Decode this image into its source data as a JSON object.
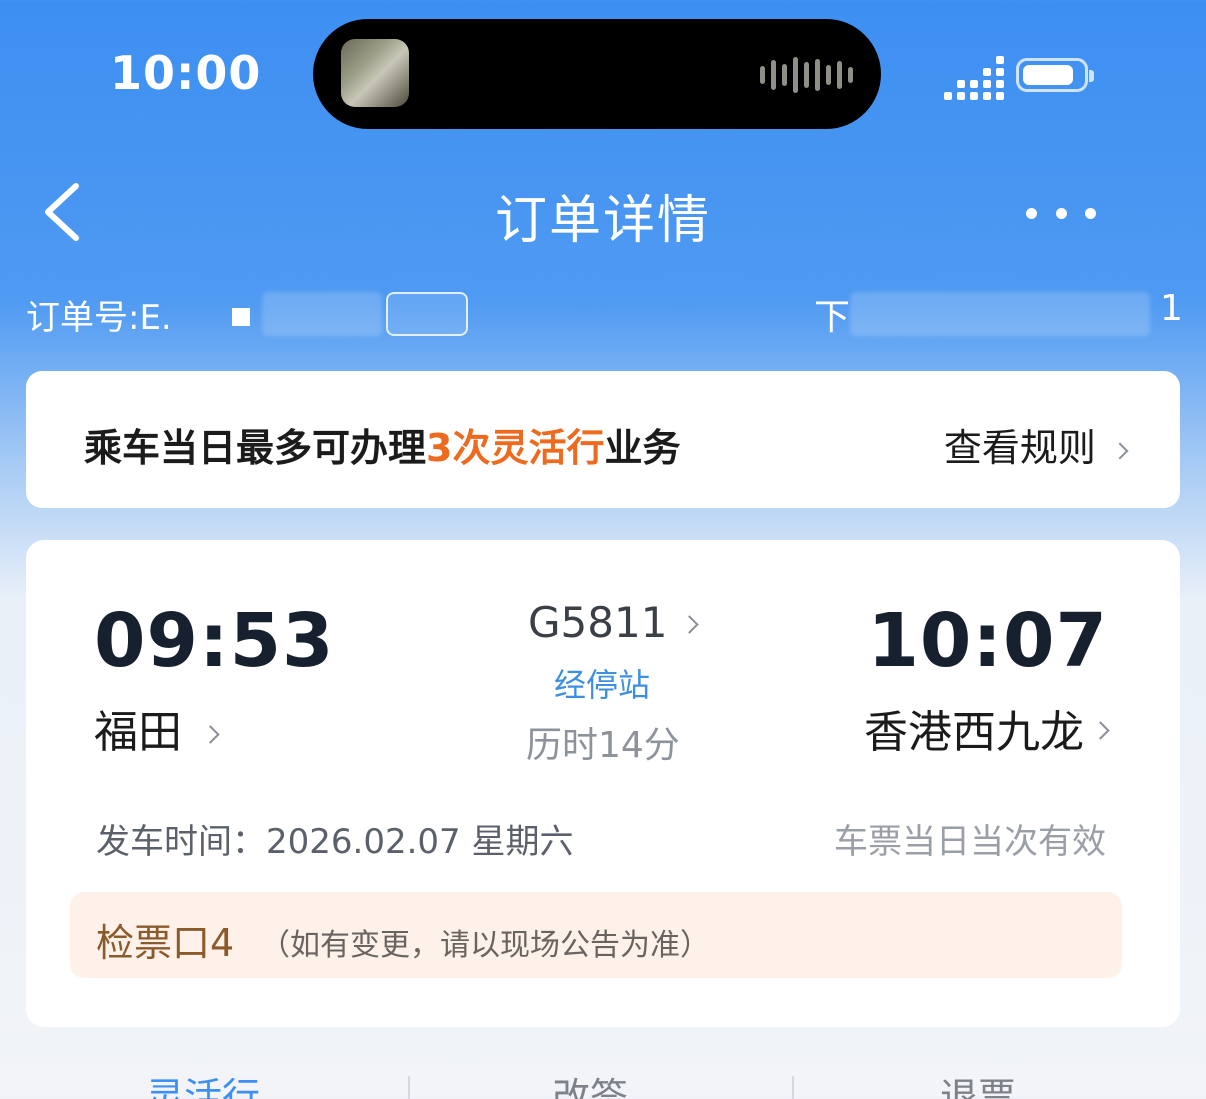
{
  "status_bar": {
    "time": "10:00"
  },
  "nav": {
    "title": "订单详情",
    "back_icon": "chevron-left-icon",
    "more_icon": "more-dots-icon"
  },
  "order": {
    "label": "订单号:E.",
    "right_prefix": "下",
    "right_suffix": "1"
  },
  "notice": {
    "text_prefix": "乘车当日最多可办理",
    "text_highlight": "3次灵活行",
    "text_suffix": "业务",
    "link_label": "查看规则",
    "highlight_color": "#ee6a1e"
  },
  "trip": {
    "departure_time": "09:53",
    "departure_station": "福田",
    "train_number": "G5811",
    "stops_label": "经停站",
    "duration": "历时14分",
    "arrival_time": "10:07",
    "arrival_station": "香港西九龙",
    "depart_date_label": "发车时间：2026.02.07 星期六",
    "validity_note": "车票当日当次有效",
    "gate": "检票口4",
    "gate_note": "（如有变更，请以现场公告为准）"
  },
  "bottom_tabs": [
    "灵活行",
    "改签",
    "退票"
  ],
  "colors": {
    "header_blue": "#3d8ff2",
    "gate_bg": "#fdf1ea",
    "gate_text": "#8b5a2b"
  }
}
